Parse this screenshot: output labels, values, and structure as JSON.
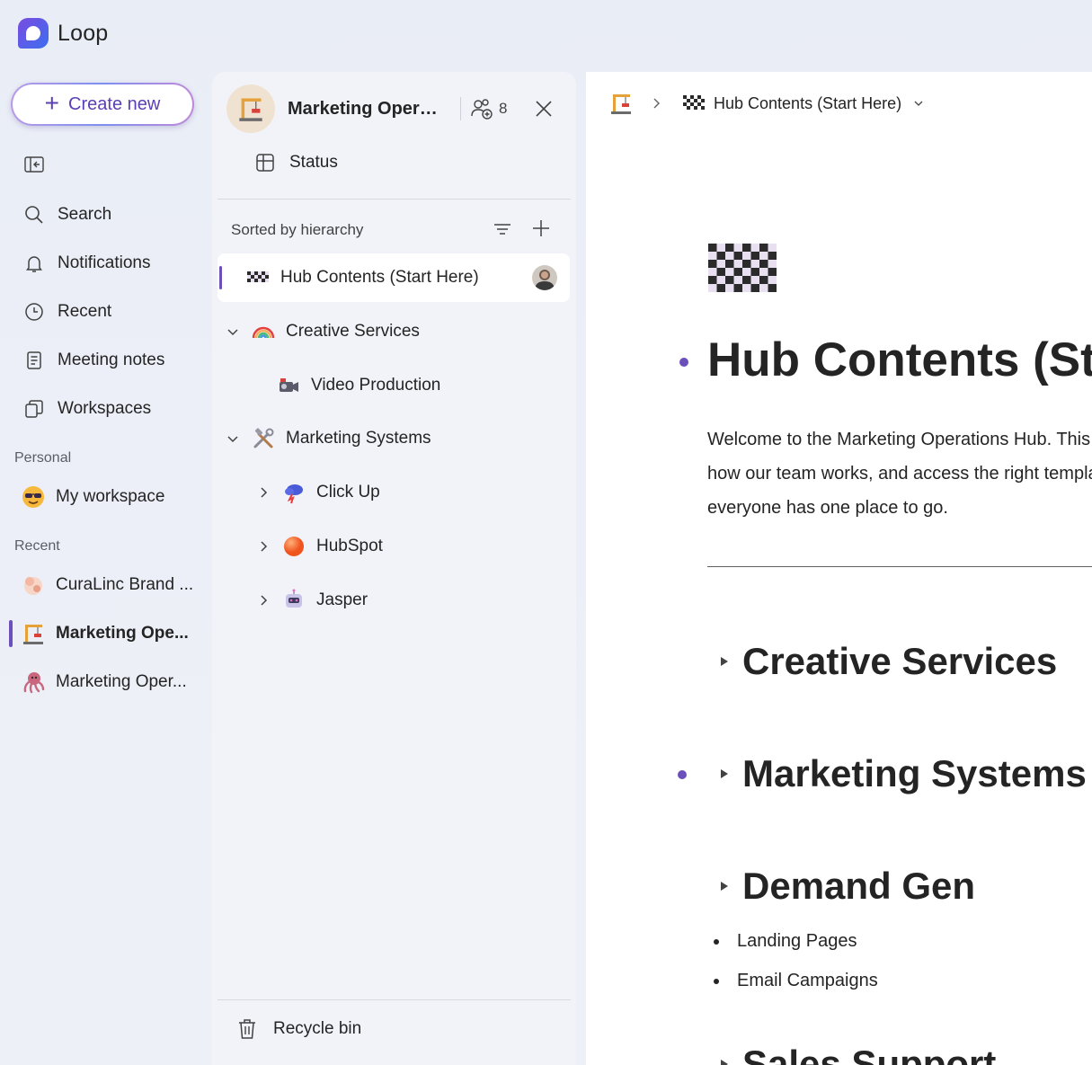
{
  "app": {
    "name": "Loop"
  },
  "nav": {
    "create_label": "Create new",
    "items": [
      {
        "label": "Search",
        "icon": "search-icon"
      },
      {
        "label": "Notifications",
        "icon": "bell-icon"
      },
      {
        "label": "Recent",
        "icon": "clock-icon"
      },
      {
        "label": "Meeting notes",
        "icon": "notes-icon"
      },
      {
        "label": "Workspaces",
        "icon": "workspaces-icon"
      }
    ],
    "personal_label": "Personal",
    "personal_item": {
      "label": "My workspace",
      "icon": "sunglasses-emoji-icon"
    },
    "recent_label": "Recent",
    "recent_items": [
      {
        "label": "CuraLinc Brand ...",
        "icon": "baby-emoji-icon"
      },
      {
        "label": "Marketing Ope...",
        "icon": "crane-emoji-icon",
        "active": true
      },
      {
        "label": "Marketing Oper...",
        "icon": "octopus-emoji-icon"
      }
    ]
  },
  "workspace": {
    "title": "Marketing Operati...",
    "member_count": "8",
    "status_label": "Status",
    "sort_label": "Sorted by hierarchy",
    "tree": [
      {
        "label": "Hub Contents (Start Here)",
        "icon": "checkered-flag-icon",
        "selected": true
      },
      {
        "label": "Creative Services",
        "icon": "rainbow-icon",
        "expanded": true
      },
      {
        "label": "Video Production",
        "icon": "video-camera-icon"
      },
      {
        "label": "Marketing Systems",
        "icon": "tools-icon",
        "expanded": true
      },
      {
        "label": "Click Up",
        "icon": "storm-cloud-icon"
      },
      {
        "label": "HubSpot",
        "icon": "orange-circle-icon"
      },
      {
        "label": "Jasper",
        "icon": "robot-icon"
      }
    ],
    "recycle_label": "Recycle bin"
  },
  "page": {
    "breadcrumb_current": "Hub Contents (Start Here)",
    "title": "Hub Contents (Start Here)",
    "intro_lines": [
      "Welcome to the Marketing Operations Hub. This is where you can learn",
      "how our team works, and access the right templates and resources so",
      "everyone has one place to go."
    ],
    "headings": [
      {
        "text": "Creative Services"
      },
      {
        "text": "Marketing Systems (MarTech)"
      },
      {
        "text": "Demand Gen"
      }
    ],
    "demand_gen_items": [
      "Landing Pages",
      "Email Campaigns"
    ],
    "next_heading": "Sales Support"
  },
  "colors": {
    "accent": "#6b4fbb",
    "brand_gradient_start": "#7a4be0",
    "brand_gradient_end": "#3b6ff0"
  }
}
